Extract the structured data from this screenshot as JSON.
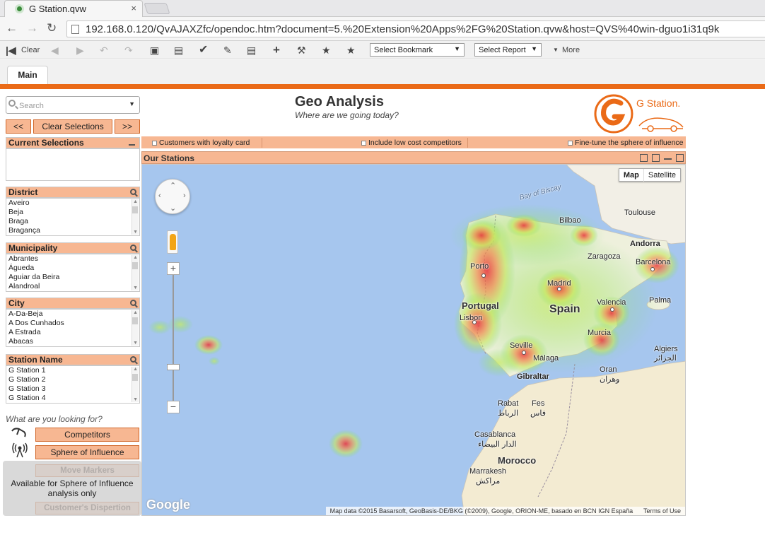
{
  "browser": {
    "tab_title": "G Station.qvw",
    "tab_close": "×",
    "url": "192.168.0.120/QvAJAXZfc/opendoc.htm?document=5.%20Extension%20Apps%2FG%20Station.qvw&host=QVS%40win-dguo1i31q9k"
  },
  "toolbar": {
    "clear_label": "Clear",
    "bookmark_select": "Select Bookmark",
    "report_select": "Select Report",
    "more_label": "More"
  },
  "sheet_tabs": [
    "Main"
  ],
  "search": {
    "placeholder": "Search"
  },
  "nav": {
    "back": "<<",
    "clear_selections": "Clear Selections",
    "forward": ">>"
  },
  "current_selections": {
    "title": "Current Selections"
  },
  "listboxes": [
    {
      "title": "District",
      "items": [
        "Aveiro",
        "Beja",
        "Braga",
        "Bragança"
      ]
    },
    {
      "title": "Municipality",
      "items": [
        "Abrantes",
        "Águeda",
        "Aguiar da Beira",
        "Alandroal"
      ]
    },
    {
      "title": "City",
      "items": [
        "A-Da-Beja",
        "A Dos Cunhados",
        "A Estrada",
        "Abacas"
      ]
    },
    {
      "title": "Station Name",
      "items": [
        "G Station 1",
        "G Station 2",
        "G Station 3",
        "G Station 4"
      ]
    }
  ],
  "actions": {
    "question": "What are you looking for?",
    "competitors": "Competitors",
    "sphere": "Sphere of Influence",
    "move_markers": "Move Markers",
    "customers_dispersion": "Customer's Dispertion",
    "overlay_text": "Available for Sphere of Influence analysis only"
  },
  "header": {
    "title": "Geo Analysis",
    "subtitle": "Where are we going today?",
    "logo_text": "G Station."
  },
  "options": {
    "loyalty": "Customers with loyalty card",
    "lowcost": "Include low cost competitors",
    "finetune": "Fine-tune the sphere of influence"
  },
  "map": {
    "caption": "Our Stations",
    "type_map": "Map",
    "type_satellite": "Satellite",
    "google": "Google",
    "attribution": "Map data ©2015 Basarsoft, GeoBasis-DE/BKG (©2009), Google, ORION-ME, basado en BCN IGN España",
    "terms": "Terms of Use",
    "labels": {
      "bay": "Bay of Biscay",
      "bilbao": "Bilbao",
      "toulouse": "Toulouse",
      "andorra": "Andorra",
      "porto": "Porto",
      "zaragoza": "Zaragoza",
      "barcelona": "Barcelona",
      "madrid": "Madrid",
      "portugal": "Portugal",
      "spain": "Spain",
      "valencia": "Valencia",
      "palma": "Palma",
      "lisbon": "Lisbon",
      "murcia": "Murcia",
      "seville": "Seville",
      "malaga": "Málaga",
      "gibraltar": "Gibraltar",
      "algiers": "Algiers",
      "algiers_ar": "الجزائر",
      "oran": "Oran",
      "oran_ar": "وهران",
      "rabat": "Rabat",
      "rabat_ar": "الرباط",
      "fes": "Fes",
      "fes_ar": "فاس",
      "casablanca": "Casablanca",
      "casablanca_ar": "الدار البيضاء",
      "morocco": "Morocco",
      "marrakesh": "Marrakesh",
      "marrakesh_ar": "مراكش"
    }
  },
  "colors": {
    "accent": "#ea6a17",
    "panel": "#f7b792",
    "sea": "#a6c6ee",
    "land": "#f2efe6"
  }
}
